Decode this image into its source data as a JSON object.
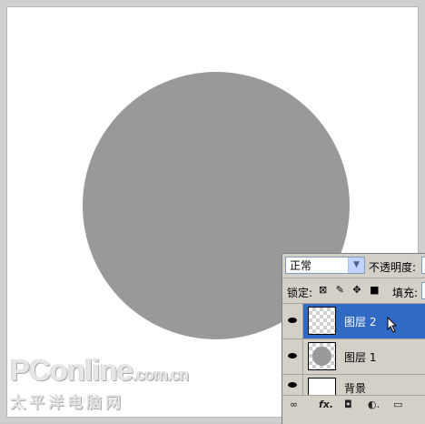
{
  "watermark": {
    "main": "PConline",
    "suffix": ".com.cn",
    "sub": "太平洋电脑网"
  },
  "layers_panel": {
    "blend_mode": "正常",
    "opacity_label": "不透明度:",
    "lock_label": "锁定:",
    "lock_icons": "⊠ ✎ ✥ ■",
    "fill_label": "填充:",
    "layers": [
      {
        "name": "图层 2",
        "selected": true,
        "thumbnail": "transparent"
      },
      {
        "name": "图层 1",
        "selected": false,
        "thumbnail": "gray-circle"
      },
      {
        "name": "背景",
        "selected": false,
        "thumbnail": "white"
      }
    ],
    "bottom_icons": [
      "link-icon",
      "fx-icon",
      "mask-icon",
      "adjustment-icon",
      "folder-icon"
    ],
    "bottom_labels": {
      "link": "∞",
      "fx": "fx.",
      "mask": "◘",
      "adjust": "◐.",
      "folder": "▭"
    }
  },
  "colors": {
    "canvas": "#ffffff",
    "circle": "#999999",
    "selection": "#316ac5",
    "panel": "#d4d0c8"
  }
}
